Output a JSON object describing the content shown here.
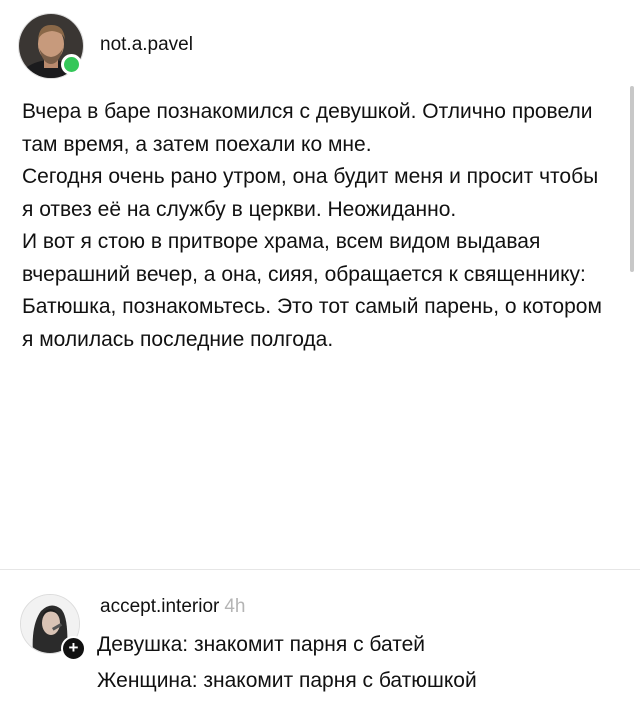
{
  "post": {
    "username": "not.a.pavel",
    "paragraphs": [
      "Вчера в баре познакомился с девушкой. Отлично провели там время, а затем поехали ко мне.",
      "Сегодня очень рано утром, она будит меня и просит чтобы я отвез её на службу в церкви. Неожиданно.",
      "И вот я стою в притворе храма, всем видом выдавая вчерашний вечер, а она, сияя, обращается к священнику: Батюшка, познакомьтесь. Это тот самый парень, о котором я молилась последние полгода."
    ]
  },
  "comment": {
    "username": "accept.interior",
    "time": "4h",
    "add_symbol": "+",
    "lines": [
      "Девушка: знакомит парня с батей",
      "Женщина: знакомит парня с батюшкой"
    ]
  },
  "colors": {
    "online": "#34c759",
    "time": "#b5b5b5"
  }
}
